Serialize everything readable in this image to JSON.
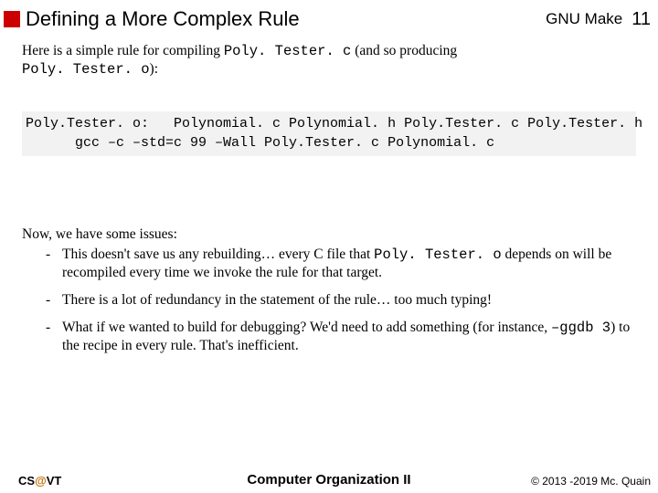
{
  "header": {
    "title": "Defining a More Complex Rule",
    "topic": "GNU Make",
    "page": "11"
  },
  "intro": {
    "t1": "Here is a simple rule for compiling ",
    "c1": "Poly. Tester. c",
    "t2": " (and so producing ",
    "c2": "Poly. Tester. o",
    "t3": "):"
  },
  "codeblock": "Poly.Tester. o:   Polynomial. c Polynomial. h Poly.Tester. c Poly.Tester. h\n      gcc –c –std=c 99 –Wall Poly.Tester. c Polynomial. c",
  "issues": {
    "lead": "Now, we have some issues:",
    "i1a": "This doesn't save us any rebuilding… every C file that ",
    "i1b": "Poly. Tester. o",
    "i1c": " depends on will be recompiled every time we invoke the rule for that target.",
    "i2": "There is a lot of redundancy in the statement of the rule… too much typing!",
    "i3a": "What if we wanted to build for debugging?  We'd need to add something (for instance, ",
    "i3b": "–ggdb 3",
    "i3c": ") to the recipe in every rule.  That's inefficient."
  },
  "footer": {
    "cs": "CS",
    "at": "@",
    "vt": "VT",
    "center": "Computer Organization II",
    "right": "© 2013 -2019 Mc. Quain"
  }
}
